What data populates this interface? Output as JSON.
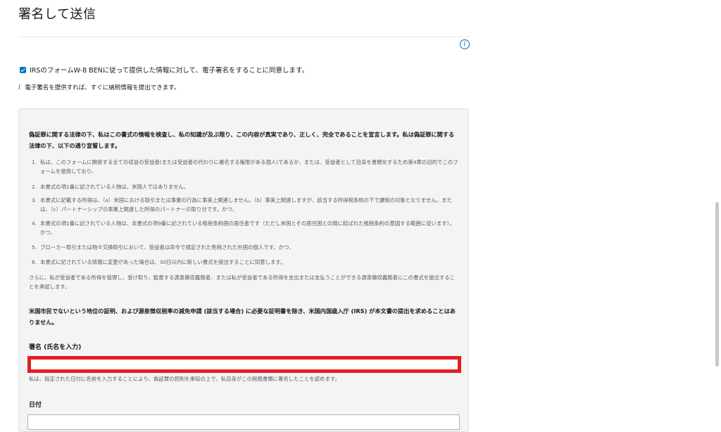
{
  "page": {
    "title": "署名して送信"
  },
  "consent": {
    "checked": true,
    "label": "IRSのフォームW-8 BENに従って提供した情報に対して、電子署名をすることに同意します。"
  },
  "note": {
    "icon": "i",
    "text": "電子署名を提供すれば、すぐに納税情報を提出できます。"
  },
  "declaration": {
    "intro": "偽証罪に関する法律の下、私はこの書式の情報を検査し、私の知識が及ぶ限り、この内容が真実であり、正しく、完全であることを宣言します。私は偽証罪に関する法律の下、以下の通り宣誓します。",
    "items": [
      {
        "num": "1.",
        "text": "私は、このフォームに関係する全ての収益の受益者(または受益者の代わりに署名する権限がある個人)であるか、または、受益者として自身を書類化するため第4章の目的でこのフォームを使用しており、"
      },
      {
        "num": "2.",
        "text": "本書式の項1番に記されている人物は、米国人ではありません。"
      },
      {
        "num": "3.",
        "text": "本書式に記載する所得は、（a）米国における取引または事業の行為に事実上関連しません。（b）事実上関連しますが、該当する所得税条約の下で課税の対象となりません。または、（c）パートナーシップの事業上関連した所得のパートナーの取り分です。かつ、"
      },
      {
        "num": "4.",
        "text": "本書式の項1番に記されている人物は、本書式の項9番に記されている租税条約国の居住者です（ただし米国とその居住国との間に結ばれた租税条約の意図する範囲に従います）。かつ、"
      },
      {
        "num": "5.",
        "text": "ブローカー取引または物々交換取引において、受益者は命令で規定された免税された外国の個人です。かつ、"
      },
      {
        "num": "6.",
        "text": "本書式に記されている情報に変更があった場合は、30日以内に新しい書式を提出することに同意します。"
      }
    ],
    "authorization": "さらに、私が受益者である所得を管理し、受け取り、監督する源泉徴収義務者、または私が受益者である所得を支出または支払うことができる源泉徴収義務者にこの書式を提出することを承認します。",
    "irs_statement": "米国市民でないという地位の証明、および源泉徴収税率の減免申請 (該当する場合) に必要な証明書を除き、米国内国歳入庁 (IRS) が本文書の提出を求めることはありません。"
  },
  "signature": {
    "label": "署名 (氏名を入力)",
    "value": "",
    "placeholder": "",
    "hint": "私は、指定された日付に名前を入力することにより、偽証罪の罰則を承知の上で、私自身がこの税務書類に署名したことを認めます。"
  },
  "date": {
    "label": "日付",
    "value": ""
  },
  "icons": {
    "info": "info-circle-icon",
    "note": "info-italic-icon",
    "checkbox": "checkbox-checked-icon"
  },
  "colors": {
    "accent": "#0073bb",
    "highlight_border": "#e21f26",
    "panel_bg": "#f4f4f4"
  }
}
